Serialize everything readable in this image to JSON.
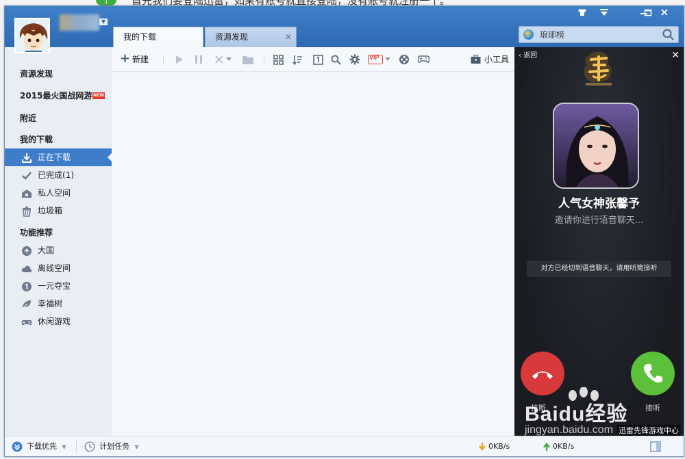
{
  "background_page": {
    "step_number": "1",
    "text": "首先我们要登陆迅雷，如果有账号就直接登陆，没有账号就注册一个。"
  },
  "window": {
    "tabs": [
      {
        "label": "我的下载"
      },
      {
        "label": "资源发现"
      }
    ],
    "search": {
      "value": "琅琊榜"
    }
  },
  "sidebar": {
    "items": [
      {
        "label": "资源发现"
      },
      {
        "label": "2015最火国战网游",
        "badge": "NEW"
      },
      {
        "label": "附近"
      },
      {
        "label": "我的下载"
      },
      {
        "label": "正在下载"
      },
      {
        "label": "已完成(1)"
      },
      {
        "label": "私人空间"
      },
      {
        "label": "垃圾箱"
      },
      {
        "label": "功能推荐"
      },
      {
        "label": "大国"
      },
      {
        "label": "离线空间"
      },
      {
        "label": "一元夺宝"
      },
      {
        "label": "幸福树"
      },
      {
        "label": "休闲游戏"
      }
    ]
  },
  "toolbar": {
    "new_label": "新建",
    "tools_label": "小工具",
    "vip_label": "VIP"
  },
  "ad": {
    "back_label": "返回",
    "title": "人气女神张馨予",
    "subtitle": "邀请你进行语音聊天...",
    "notice": "对方已经切到语音聊天，请用听筒接听",
    "decline_label": "挂断",
    "accept_label": "接听",
    "footer": "迅雷先锋游戏中心"
  },
  "statusbar": {
    "priority_label": "下载优先",
    "schedule_label": "计划任务",
    "download_speed": "0KB/s",
    "upload_speed": "0KB/s"
  },
  "watermark": {
    "brand": "Baidu经验",
    "url": "jingyan.baidu.com"
  },
  "colors": {
    "titlebar": "#3f7fc8",
    "active_item": "#3d7dc9",
    "decline": "#d8393b",
    "accept": "#5cc03a"
  }
}
